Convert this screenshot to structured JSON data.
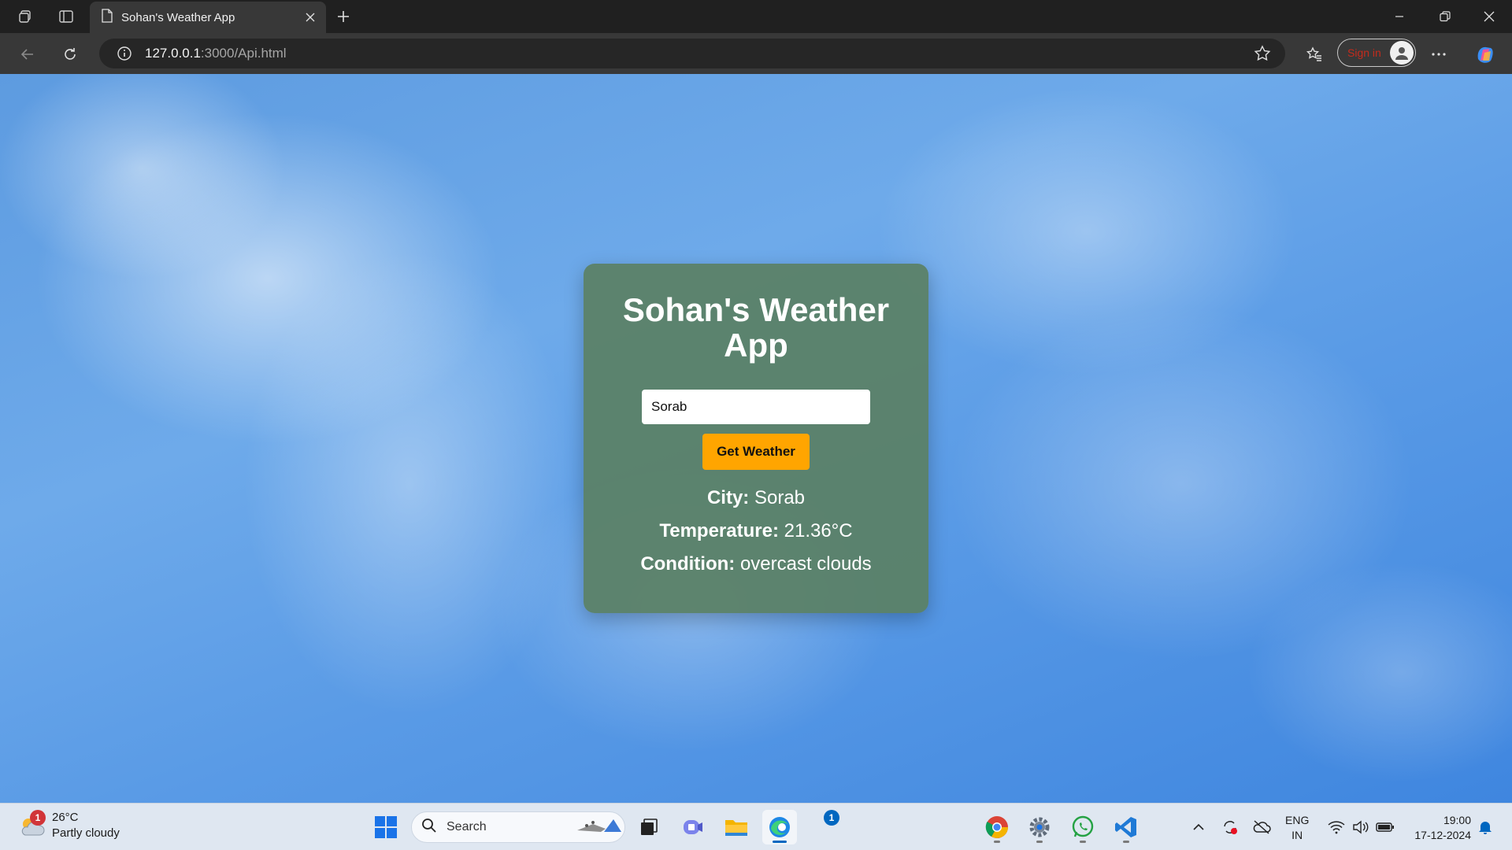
{
  "browser": {
    "tab_title": "Sohan's Weather App",
    "url_host": "127.0.0.1",
    "url_rest": ":3000/Api.html",
    "signin_label": "Sign in"
  },
  "app": {
    "title": "Sohan's Weather App",
    "city_input_value": "Sorab",
    "button_label": "Get Weather",
    "city_label": "City:",
    "city_value": "Sorab",
    "temperature_label": "Temperature:",
    "temperature_value": "21.36°C",
    "condition_label": "Condition:",
    "condition_value": "overcast clouds"
  },
  "taskbar": {
    "weather_temp": "26°C",
    "weather_desc": "Partly cloudy",
    "weather_badge": "1",
    "search_label": "Search",
    "teams_badge": "1",
    "lang_line1": "ENG",
    "lang_line2": "IN",
    "time": "19:00",
    "date": "17-12-2024"
  },
  "colors": {
    "card_bg": "#5a8064",
    "button_bg": "#ffa500",
    "sky_top": "#6eaaea",
    "sky_bottom": "#3f86df",
    "chrome_dark": "#202020",
    "taskbar_bg": "#dfe7f1"
  }
}
